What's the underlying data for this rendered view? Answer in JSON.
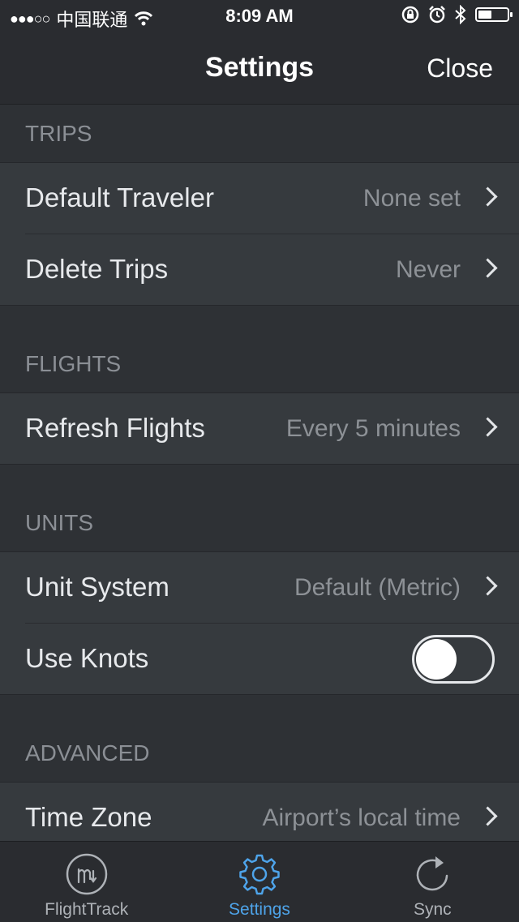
{
  "status_bar": {
    "signal": "●●●○○",
    "carrier": "中国联通",
    "time": "8:09 AM"
  },
  "nav": {
    "title": "Settings",
    "close_label": "Close"
  },
  "sections": [
    {
      "header": "TRIPS",
      "rows": [
        {
          "label": "Default Traveler",
          "value": "None set"
        },
        {
          "label": "Delete Trips",
          "value": "Never"
        }
      ]
    },
    {
      "header": "FLIGHTS",
      "rows": [
        {
          "label": "Refresh Flights",
          "value": "Every 5 minutes"
        }
      ]
    },
    {
      "header": "UNITS",
      "rows": [
        {
          "label": "Unit System",
          "value": "Default (Metric)"
        },
        {
          "label": "Use Knots",
          "toggle": false
        }
      ]
    },
    {
      "header": "ADVANCED",
      "rows": [
        {
          "label": "Time Zone",
          "value": "Airport’s local time"
        }
      ]
    }
  ],
  "tab_bar": {
    "tabs": [
      {
        "label": "FlightTrack",
        "icon": "flighttrack-icon",
        "active": false
      },
      {
        "label": "Settings",
        "icon": "gear-icon",
        "active": true
      },
      {
        "label": "Sync",
        "icon": "sync-icon",
        "active": false
      }
    ]
  },
  "colors": {
    "accent": "#4ea4ea",
    "background": "#2c2f33",
    "row": "#363a3e"
  }
}
